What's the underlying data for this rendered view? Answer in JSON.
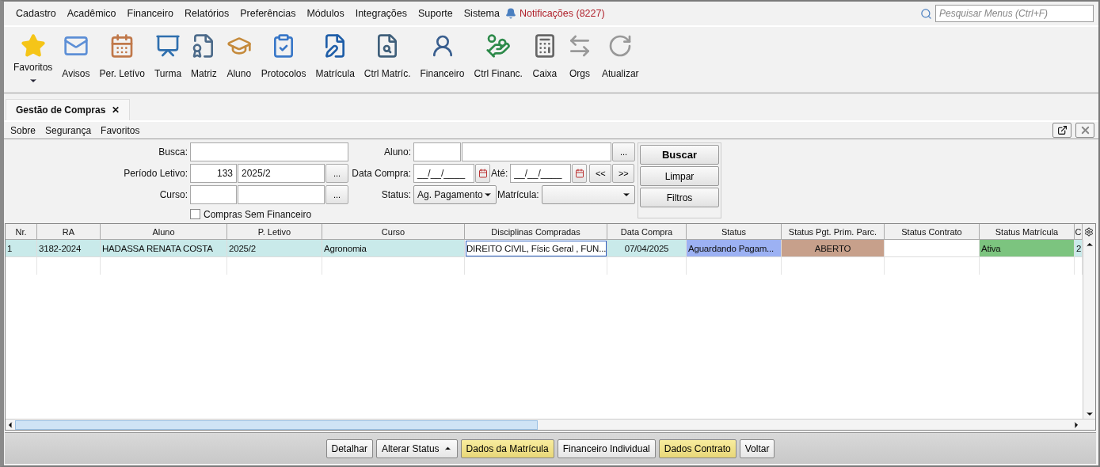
{
  "menu": [
    {
      "label": "Cadastro"
    },
    {
      "label": "Acadêmico"
    },
    {
      "label": "Financeiro"
    },
    {
      "label": "Relatórios"
    },
    {
      "label": "Preferências"
    },
    {
      "label": "Módulos"
    },
    {
      "label": "Integrações"
    },
    {
      "label": "Suporte"
    },
    {
      "label": "Sistema"
    }
  ],
  "notifications": {
    "label": "Notificações (8227)"
  },
  "menu_search": {
    "placeholder": "Pesquisar Menus (Ctrl+F)"
  },
  "toolbar": [
    {
      "label": "Favoritos",
      "dropdown": true,
      "disabled": false
    },
    {
      "label": "Avisos",
      "dropdown": false,
      "disabled": false
    },
    {
      "label": "Per. Letívo",
      "dropdown": false,
      "disabled": false
    },
    {
      "label": "Turma",
      "dropdown": false,
      "disabled": false
    },
    {
      "label": "Matriz",
      "dropdown": false,
      "disabled": false
    },
    {
      "label": "Aluno",
      "dropdown": false,
      "disabled": false
    },
    {
      "label": "Protocolos",
      "dropdown": false,
      "disabled": false
    },
    {
      "label": "Matrícula",
      "dropdown": false,
      "disabled": false
    },
    {
      "label": "Ctrl Matríc.",
      "dropdown": false,
      "disabled": false
    },
    {
      "label": "Financeiro",
      "dropdown": false,
      "disabled": false
    },
    {
      "label": "Ctrl Financ.",
      "dropdown": false,
      "disabled": false
    },
    {
      "label": "Caixa",
      "dropdown": false,
      "disabled": false
    },
    {
      "label": "Orgs",
      "dropdown": false,
      "disabled": true
    },
    {
      "label": "Atualizar",
      "dropdown": false,
      "disabled": true
    }
  ],
  "tabs": [
    {
      "label": "Gestão de Compras",
      "selected": true,
      "close": "✕"
    }
  ],
  "submenu": [
    {
      "label": "Sobre"
    },
    {
      "label": "Segurança"
    },
    {
      "label": "Favoritos"
    }
  ],
  "filters": {
    "busca": {
      "label": "Busca:"
    },
    "periodo": {
      "label": "Período Letivo:",
      "code": "133",
      "name": "2025/2",
      "button": "..."
    },
    "curso": {
      "label": "Curso:",
      "button": "..."
    },
    "sem_financeiro": {
      "label": "Compras Sem Financeiro",
      "checked": false
    },
    "aluno": {
      "label": "Aluno:",
      "button": "..."
    },
    "data_compra": {
      "label": "Data Compra:",
      "value": "__/__/____"
    },
    "ate": {
      "label": "Até:",
      "value": "__/__/____"
    },
    "prev": "<<",
    "next": ">>",
    "status": {
      "label": "Status:",
      "value": "Ag. Pagamento"
    },
    "matricula": {
      "label": "Matrícula:"
    }
  },
  "actions": [
    {
      "label": "Buscar",
      "kind": "primary"
    },
    {
      "label": "Limpar",
      "kind": "normal"
    },
    {
      "label": "Filtros",
      "kind": "normal"
    }
  ],
  "table": {
    "columns": [
      "Nr.",
      "RA",
      "Aluno",
      "P. Letivo",
      "Curso",
      "Disciplinas Compradas",
      "Data Compra",
      "Status",
      "Status Pgt. Prim. Parc.",
      "Status Contrato",
      "Status Matrícula",
      "C"
    ],
    "rows": [
      {
        "cells": [
          {
            "text": "1",
            "color": "#c9eaea"
          },
          {
            "text": "3182-2024",
            "color": "#c9eaea"
          },
          {
            "text": "HADASSA RENATA COSTA",
            "color": "#c9eaea"
          },
          {
            "text": "2025/2",
            "color": "#c9eaea"
          },
          {
            "text": "Agronomia",
            "color": "#c9eaea"
          },
          {
            "text": "DIREITO CIVIL, Físic Geral , FUN...",
            "color": "#ffffff"
          },
          {
            "text": "07/04/2025",
            "color": "#c9eaea"
          },
          {
            "text": "Aguardando Pagam...",
            "color": "#9cb1f3"
          },
          {
            "text": "ABERTO",
            "color": "#c7a08b"
          },
          {
            "text": "",
            "color": "#ffffff"
          },
          {
            "text": "Ativa",
            "color": "#7cc47f"
          },
          {
            "text": "2",
            "color": "#c9eaea"
          }
        ]
      }
    ]
  },
  "bottom_buttons": [
    {
      "label": "Detalhar",
      "highlighted": false,
      "menu": false
    },
    {
      "label": "Alterar Status",
      "highlighted": false,
      "menu": true
    },
    {
      "label": "Dados da Matrícula",
      "highlighted": true,
      "menu": false
    },
    {
      "label": "Financeiro Individual",
      "highlighted": false,
      "menu": false
    },
    {
      "label": "Dados Contrato",
      "highlighted": true,
      "menu": false
    },
    {
      "label": "Voltar",
      "highlighted": false,
      "menu": false
    }
  ]
}
